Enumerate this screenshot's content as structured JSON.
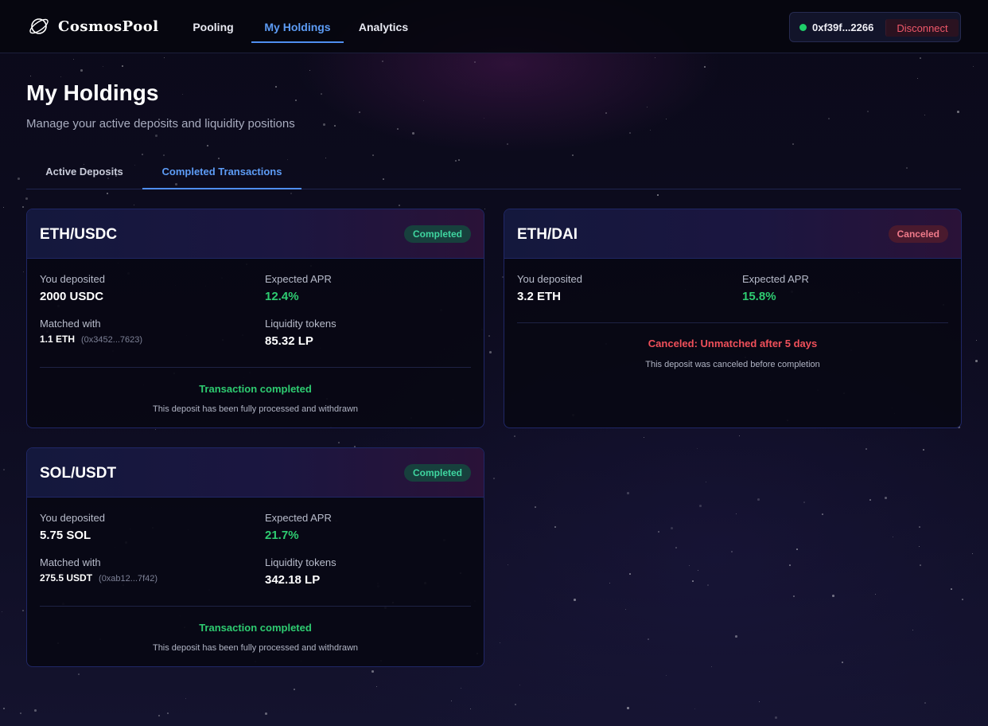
{
  "header": {
    "brand": "CosmosPool",
    "nav": [
      {
        "label": "Pooling"
      },
      {
        "label": "My Holdings"
      },
      {
        "label": "Analytics"
      }
    ],
    "wallet": {
      "address": "0xf39f...2266",
      "disconnect_label": "Disconnect",
      "status_color": "#1fcf6a"
    }
  },
  "page": {
    "title": "My Holdings",
    "subtitle": "Manage your active deposits and liquidity positions"
  },
  "tabs": [
    {
      "label": "Active Deposits"
    },
    {
      "label": "Completed Transactions",
      "active": true
    }
  ],
  "cards": [
    {
      "pair": "ETH/USDC",
      "status": "Completed",
      "deposited_label": "You deposited",
      "deposited": "2000 USDC",
      "apr_label": "Expected APR",
      "apr": "12.4%",
      "matched_label": "Matched with",
      "matched": "1.1 ETH",
      "matched_addr": "(0x3452...7623)",
      "lp_label": "Liquidity tokens",
      "lp": "85.32 LP",
      "result_title": "Transaction completed",
      "result_sub": "This deposit has been fully processed and withdrawn"
    },
    {
      "pair": "ETH/DAI",
      "status": "Canceled",
      "deposited_label": "You deposited",
      "deposited": "3.2 ETH",
      "apr_label": "Expected APR",
      "apr": "15.8%",
      "result_title": "Canceled: Unmatched after 5 days",
      "result_sub": "This deposit was canceled before completion"
    },
    {
      "pair": "SOL/USDT",
      "status": "Completed",
      "deposited_label": "You deposited",
      "deposited": "5.75 SOL",
      "apr_label": "Expected APR",
      "apr": "21.7%",
      "matched_label": "Matched with",
      "matched": "275.5 USDT",
      "matched_addr": "(0xab12...7f42)",
      "lp_label": "Liquidity tokens",
      "lp": "342.18 LP",
      "result_title": "Transaction completed",
      "result_sub": "This deposit has been fully processed and withdrawn"
    }
  ],
  "colors": {
    "accent": "#4f8ef0",
    "success": "#2ecc71",
    "danger": "#f0505a",
    "background": "#0b0a1a"
  }
}
